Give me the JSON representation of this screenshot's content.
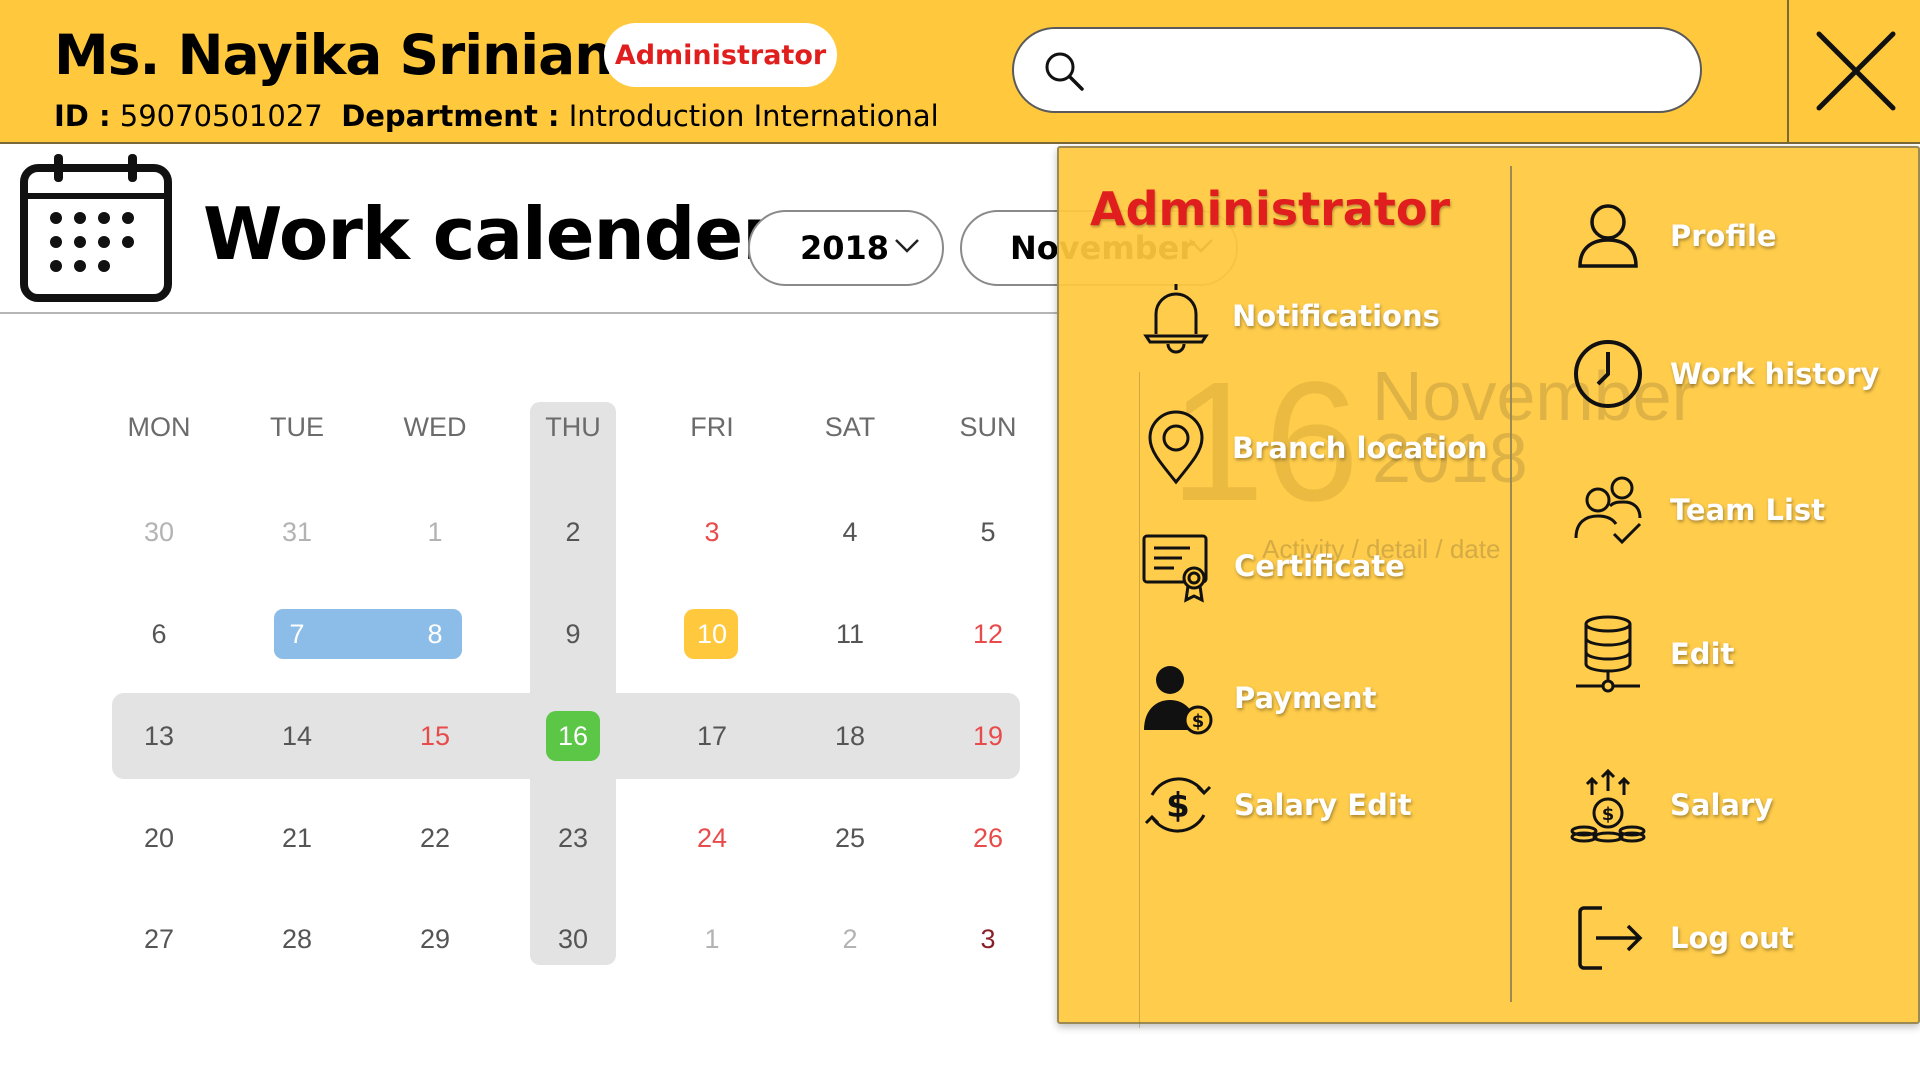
{
  "header": {
    "name": "Ms. Nayika Srinian",
    "role_badge": "Administrator",
    "id_label": "ID :",
    "id_value": "59070501027",
    "department_label": "Department :",
    "department_value": "Introduction International",
    "search_placeholder": "",
    "colors": {
      "header_bg": "#FFC83D",
      "badge_text": "#E01E1E"
    }
  },
  "title": {
    "text": "Work calender",
    "year_select": "2018",
    "month_select": "November"
  },
  "calendar": {
    "day_headers": [
      "MON",
      "TUE",
      "WED",
      "THU",
      "FRI",
      "SAT",
      "SUN"
    ],
    "weeks": [
      [
        "30",
        "31",
        "1",
        "2",
        "3",
        "4",
        "5"
      ],
      [
        "6",
        "7",
        "8",
        "9",
        "10",
        "11",
        "12"
      ],
      [
        "13",
        "14",
        "15",
        "16",
        "17",
        "18",
        "19"
      ],
      [
        "20",
        "21",
        "22",
        "23",
        "24",
        "25",
        "26"
      ],
      [
        "27",
        "28",
        "29",
        "30",
        "1",
        "2",
        "3"
      ]
    ],
    "today": "16",
    "range_highlight": [
      "7",
      "8"
    ],
    "event_day": "10",
    "colors": {
      "today": "#5CC647",
      "range": "#8CBDE8",
      "event": "#FFC83D",
      "weekend": "#E84B4B"
    }
  },
  "detail": {
    "day": "16",
    "month": "November",
    "year": "2018",
    "activity": "Activity / detail / date"
  },
  "menu": {
    "title": "Administrator",
    "left_items": [
      {
        "label": "Notifications",
        "icon": "bell-icon"
      },
      {
        "label": "Branch location",
        "icon": "location-pin-icon"
      },
      {
        "label": "Certificate",
        "icon": "certificate-icon"
      },
      {
        "label": "Payment",
        "icon": "person-dollar-icon"
      },
      {
        "label": "Salary Edit",
        "icon": "dollar-cycle-icon"
      }
    ],
    "right_items": [
      {
        "label": "Profile",
        "icon": "user-icon"
      },
      {
        "label": "Work history",
        "icon": "clock-icon"
      },
      {
        "label": "Team List",
        "icon": "team-check-icon"
      },
      {
        "label": "Edit",
        "icon": "database-icon"
      },
      {
        "label": "Salary",
        "icon": "money-growth-icon"
      },
      {
        "label": "Log out",
        "icon": "logout-icon"
      }
    ]
  }
}
